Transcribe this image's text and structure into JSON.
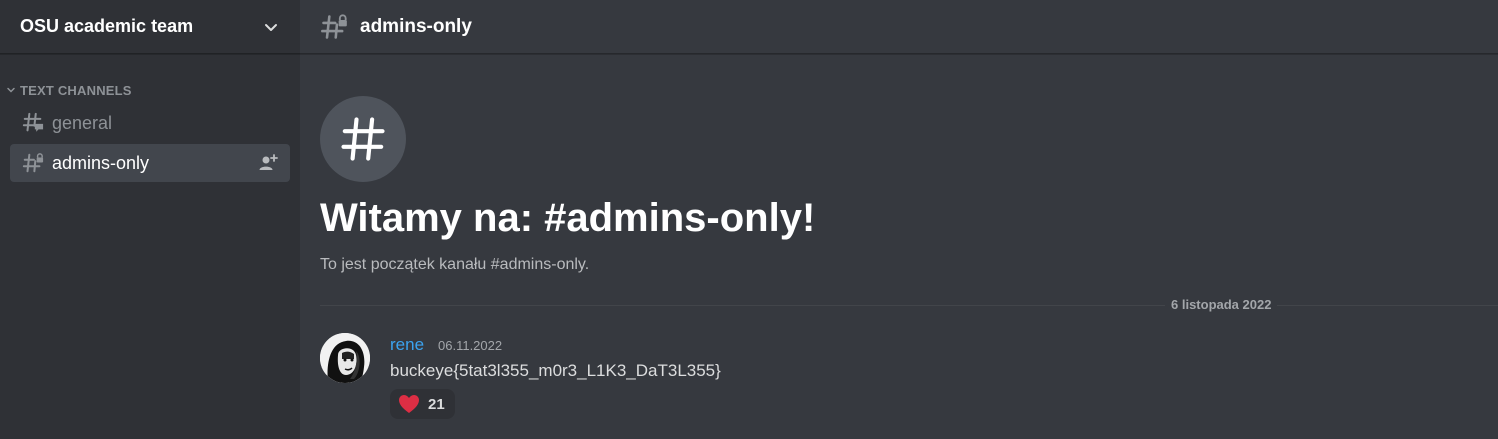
{
  "server": {
    "name": "OSU academic team",
    "menu_icon": "chevron-down-icon"
  },
  "sidebar": {
    "category": "TEXT CHANNELS",
    "channels": [
      {
        "name": "general",
        "icon": "hashtag-chat-icon",
        "active": false
      },
      {
        "name": "admins-only",
        "icon": "hashtag-lock-icon",
        "active": true,
        "action_icon": "add-member-icon"
      }
    ]
  },
  "header": {
    "channel_title": "admins-only",
    "icon": "hashtag-lock-icon"
  },
  "welcome": {
    "icon": "hashtag-icon",
    "title": "Witamy na: #admins-only!",
    "subtitle": "To jest początek kanału #admins-only."
  },
  "divider": {
    "date": "6 listopada 2022"
  },
  "messages": [
    {
      "author": "rene",
      "timestamp": "06.11.2022",
      "text": "buckeye{5tat3l355_m0r3_L1K3_DaT3L355}",
      "reaction": {
        "emoji": "heart-icon",
        "count": "21"
      }
    }
  ],
  "colors": {
    "sidebar_bg": "#2f3136",
    "main_bg": "#36393f",
    "active_channel_bg": "#42464d",
    "author_color": "#3ba3f0",
    "heart": "#dd2e44"
  }
}
